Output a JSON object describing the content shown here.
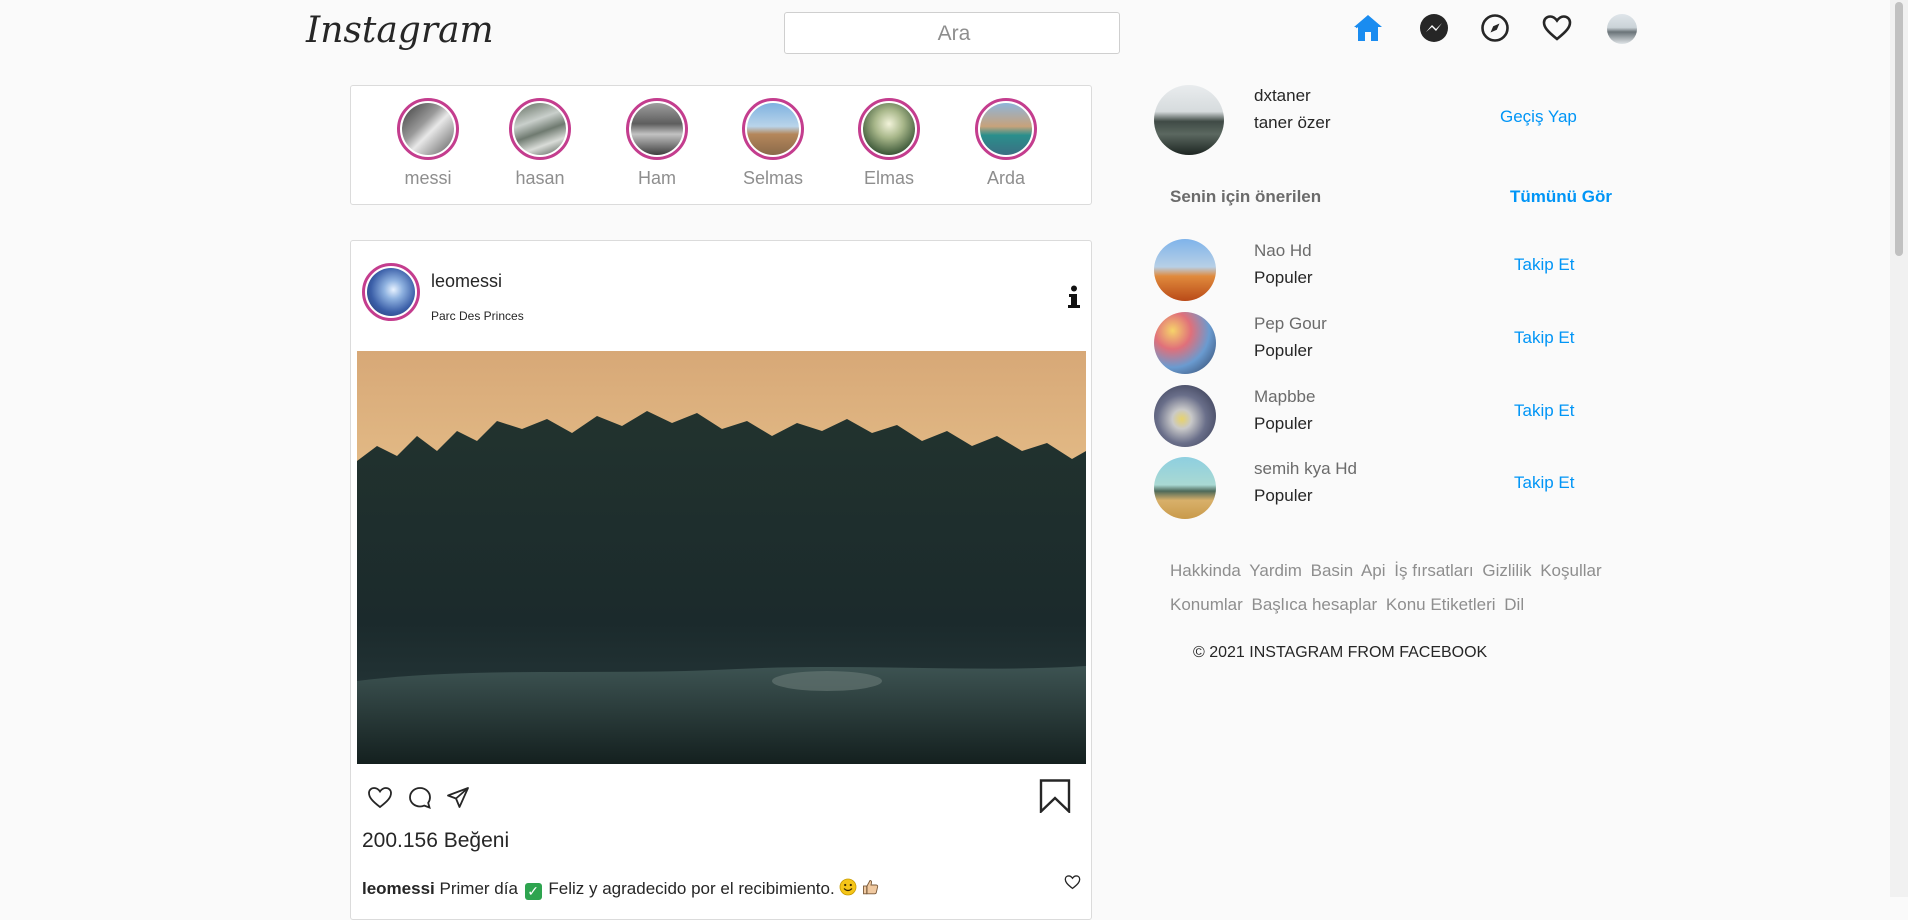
{
  "header": {
    "logo": "Instagram",
    "search_placeholder": "Ara",
    "accent": "#0095f6"
  },
  "stories": [
    {
      "name": "messi"
    },
    {
      "name": "hasan"
    },
    {
      "name": "Ham"
    },
    {
      "name": "Selmas"
    },
    {
      "name": "Elmas"
    },
    {
      "name": "Arda"
    }
  ],
  "post": {
    "username": "leomessi",
    "location": "Parc Des Princes",
    "likes": "200.156 Beğeni",
    "caption_user": "leomessi",
    "caption_text_1": "Primer día",
    "caption_text_2": "Feliz y agradecido por el recibimiento."
  },
  "profile": {
    "username": "dxtaner",
    "fullname": "taner özer",
    "switch_label": "Geçiş Yap"
  },
  "suggestions": {
    "title": "Senin için önerilen",
    "see_all": "Tümünü Gör",
    "items": [
      {
        "username": "Nao Hd",
        "sub": "Populer",
        "action": "Takip Et"
      },
      {
        "username": "Pep Gour",
        "sub": "Populer",
        "action": "Takip Et"
      },
      {
        "username": "Mapbbe",
        "sub": "Populer",
        "action": "Takip Et"
      },
      {
        "username": "semih kya Hd",
        "sub": "Populer",
        "action": "Takip Et"
      }
    ]
  },
  "footer": {
    "links": [
      "Hakkinda",
      "Yardim",
      "Basin",
      "Api",
      "İş fırsatları",
      "Gizlilik",
      "Koşullar",
      "Konumlar",
      "Başlıca hesaplar",
      "Konu Etiketleri",
      "Dil"
    ],
    "copyright": "© 2021 INSTAGRAM FROM FACEBOOK"
  }
}
